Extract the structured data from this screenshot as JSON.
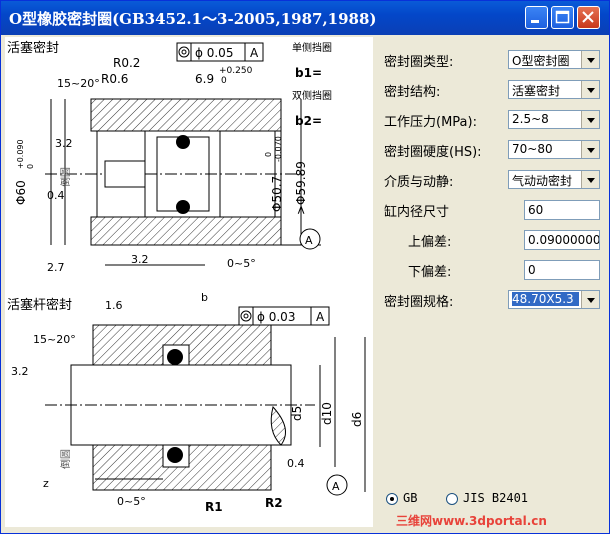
{
  "window": {
    "title": "O型橡胶密封圈(GB3452.1～3-2005,1987,1988)"
  },
  "drawing": {
    "top": {
      "title": "活塞密封",
      "side_note1": "单侧挡圈",
      "b1_label": "b1=",
      "side_note2": "双侧挡圈",
      "b2_label": "b2=",
      "tol_phi": "ϕ 0.05",
      "tol_datum": "A",
      "r02": "R0.2",
      "r06": "R0.6",
      "angle_15_20": "15~20°",
      "dim_69": "6.9",
      "dim_69_tol_up": "+0.250",
      "dim_69_tol_low": "0",
      "r32": "3.2",
      "r04": "0.4",
      "dia60": "Φ60",
      "dia60_tol_up": "+0.090",
      "dia60_tol_low": "0",
      "chamfer": "倒圆",
      "dia507": "Φ50.7",
      "dia507_tol_up": "0",
      "dia507_tol_low": "-0.070",
      "dia5989": ">Φ59.89",
      "datum_a": "A",
      "dim_27": "2.7",
      "r32b": "3.2",
      "angle_0_5": "0~5°"
    },
    "bottom": {
      "title": "活塞杆密封",
      "r16": "1.6",
      "dim_b": "b",
      "tol_phi": "ϕ 0.03",
      "tol_datum": "A",
      "angle_15_20": "15~20°",
      "r32": "3.2",
      "chamfer": "倒圆",
      "d5": "d5",
      "d10": "d10",
      "d6": "d6",
      "r04": "0.4",
      "z": "z",
      "angle_0_5": "0~5°",
      "r1": "R1",
      "r2": "R2",
      "datum_a": "A"
    }
  },
  "panel": {
    "seal_type": {
      "label": "密封圈类型:",
      "value": "O型密封圈"
    },
    "seal_structure": {
      "label": "密封结构:",
      "value": "活塞密封"
    },
    "pressure": {
      "label": "工作压力(MPa):",
      "value": "2.5~8"
    },
    "hardness": {
      "label": "密封圈硬度(HS):",
      "value": "70~80"
    },
    "medium": {
      "label": "介质与动静:",
      "value": "气动动密封"
    },
    "bore": {
      "label": "缸内径尺寸",
      "value": "60"
    },
    "upper_dev": {
      "label": "上偏差:",
      "value": "0.09000000"
    },
    "lower_dev": {
      "label": "下偏差:",
      "value": "0"
    },
    "spec": {
      "label": "密封圈规格:",
      "value": "48.70X5.3"
    },
    "standard_options": [
      {
        "label": "GB",
        "selected": true
      },
      {
        "label": "JIS B2401",
        "selected": false
      }
    ]
  },
  "watermark": "三维网www.3dportal.cn"
}
